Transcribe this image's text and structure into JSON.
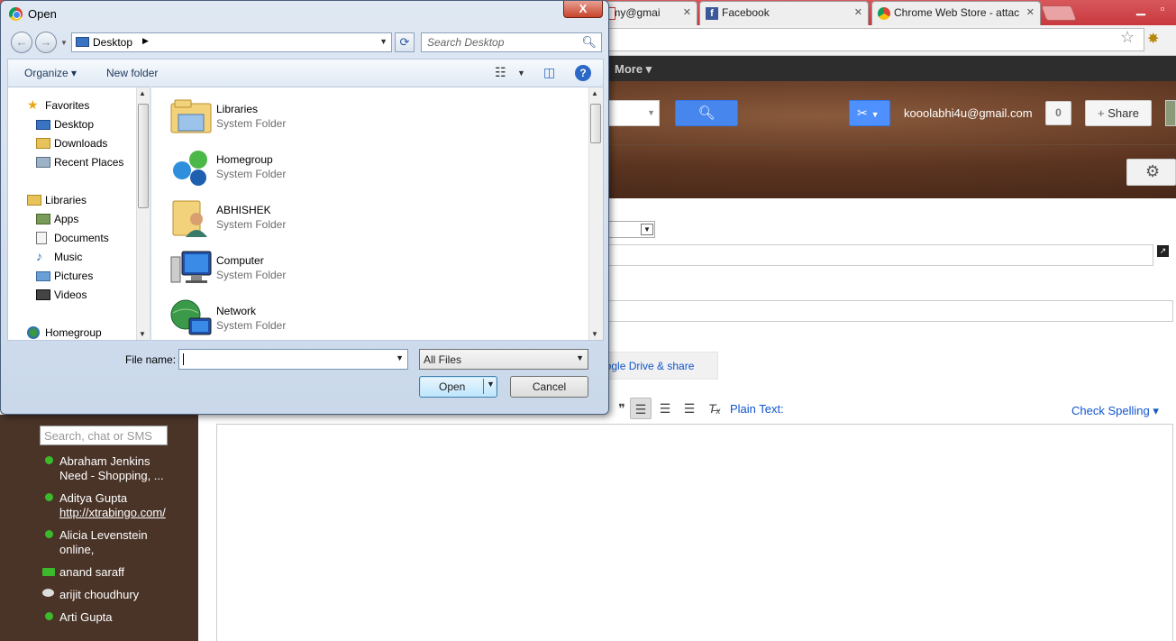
{
  "browser": {
    "tabs": [
      {
        "label": "jimmy@gmai",
        "left": 0
      },
      {
        "label": "Facebook"
      },
      {
        "label": "Chrome Web Store - attac"
      }
    ]
  },
  "gmail": {
    "nav_more": "More ▾",
    "account_email": "kooolabhi4u@gmail.com",
    "notification_count": "0",
    "share_label": "Share",
    "drive_tab_label": "oogle Drive & share",
    "plain_text_label": "Plain Text:",
    "check_spelling_label": "Check Spelling ▾",
    "chat_search_placeholder": "Search, chat or SMS",
    "contacts": [
      {
        "name": "Abraham Jenkins",
        "status": "Need - Shopping, ..."
      },
      {
        "name": "Aditya Gupta",
        "status": "http://xtrabingo.com/"
      },
      {
        "name": "Alicia Levenstein",
        "status": "online,"
      },
      {
        "name": "anand saraff",
        "status": ""
      },
      {
        "name": "arijit choudhury",
        "status": ""
      },
      {
        "name": "Arti Gupta",
        "status": ""
      }
    ]
  },
  "dialog": {
    "title": "Open",
    "close_label": "X",
    "location": "Desktop",
    "search_placeholder": "Search Desktop",
    "organize_label": "Organize ▾",
    "new_folder_label": "New folder",
    "nav_pane": {
      "favorites_label": "Favorites",
      "favorites": [
        "Desktop",
        "Downloads",
        "Recent Places"
      ],
      "libraries_label": "Libraries",
      "libraries": [
        "Apps",
        "Documents",
        "Music",
        "Pictures",
        "Videos"
      ],
      "homegroup_label": "Homegroup"
    },
    "files": [
      {
        "name": "Libraries",
        "type": "System Folder",
        "icon": "libraries-icon"
      },
      {
        "name": "Homegroup",
        "type": "System Folder",
        "icon": "homegroup-icon"
      },
      {
        "name": "ABHISHEK",
        "type": "System Folder",
        "icon": "user-folder-icon"
      },
      {
        "name": "Computer",
        "type": "System Folder",
        "icon": "computer-icon"
      },
      {
        "name": "Network",
        "type": "System Folder",
        "icon": "network-icon"
      }
    ],
    "file_name_label": "File name:",
    "file_name_value": "",
    "file_type_filter": "All Files",
    "open_label": "Open",
    "cancel_label": "Cancel"
  }
}
